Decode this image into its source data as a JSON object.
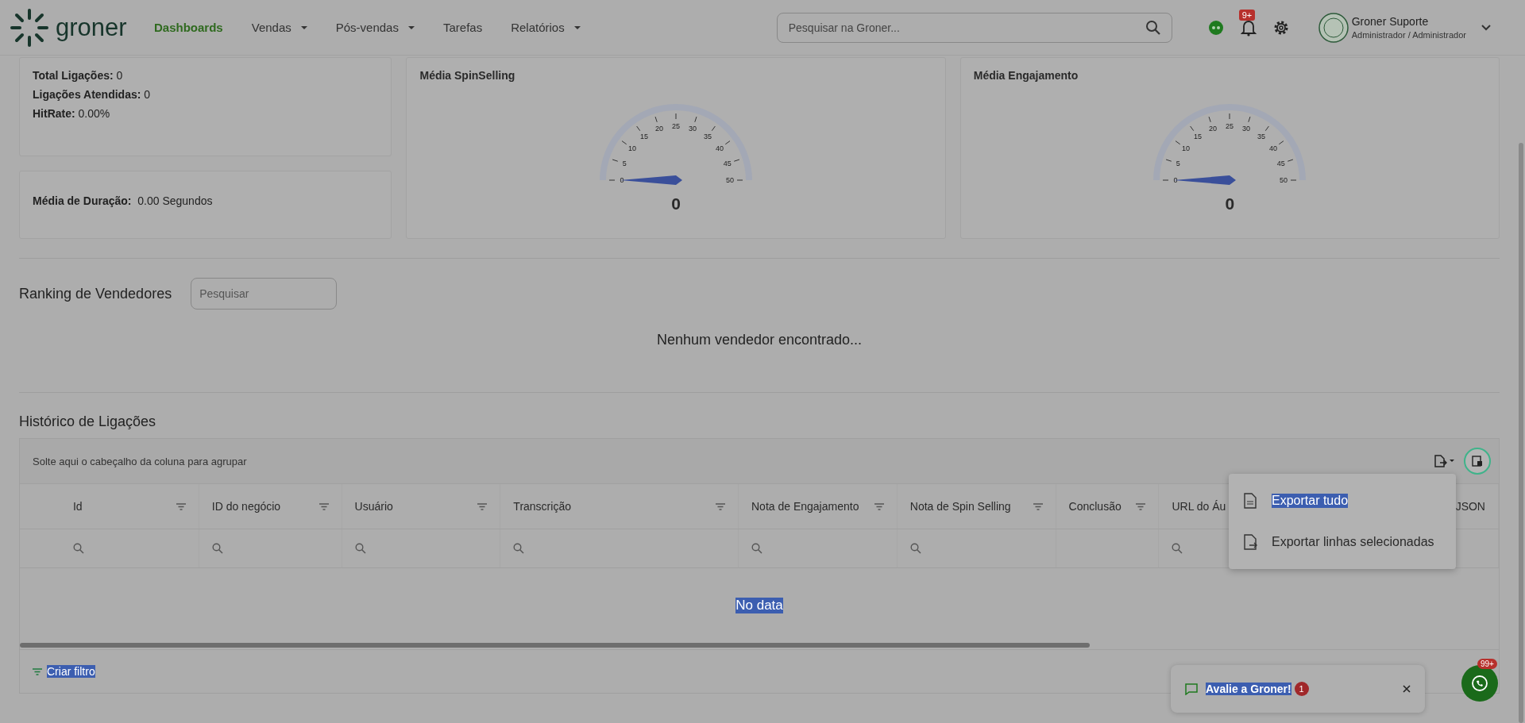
{
  "header": {
    "logo": "groner",
    "nav": [
      {
        "label": "Dashboards",
        "selected": true,
        "dropdown": false
      },
      {
        "label": "Vendas",
        "selected": false,
        "dropdown": true
      },
      {
        "label": "Pós-vendas",
        "selected": false,
        "dropdown": true
      },
      {
        "label": "Tarefas",
        "selected": false,
        "dropdown": false
      },
      {
        "label": "Relatórios",
        "selected": false,
        "dropdown": true
      }
    ],
    "search": {
      "placeholder": "Pesquisar na Groner..."
    },
    "notifications_badge": "9+",
    "user": {
      "name": "Groner Suporte",
      "role": "Administrador / Administrador"
    }
  },
  "stats": [
    {
      "label": "Total Ligações:",
      "value": "0"
    },
    {
      "label": "Ligações Atendidas:",
      "value": "0"
    },
    {
      "label": "HitRate:",
      "value": "0.00%"
    }
  ],
  "duration": {
    "label": "Média de Duração:",
    "value": "0.00 Segundos"
  },
  "gauges": [
    {
      "title": "Média SpinSelling",
      "ticks": [
        "0",
        "5",
        "10",
        "15",
        "20",
        "25",
        "30",
        "35",
        "40",
        "45",
        "50"
      ],
      "value": "0"
    },
    {
      "title": "Média Engajamento",
      "ticks": [
        "0",
        "5",
        "10",
        "15",
        "20",
        "25",
        "30",
        "35",
        "40",
        "45",
        "50"
      ],
      "value": "0"
    }
  ],
  "ranking": {
    "title": "Ranking de Vendedores",
    "search": {
      "placeholder": "Pesquisar"
    },
    "empty": "Nenhum vendedor encontrado..."
  },
  "history": {
    "title": "Histórico de Ligações",
    "group_hint": "Solte aqui o cabeçalho da coluna para agrupar",
    "columns": [
      {
        "label": "Id",
        "filter": true,
        "search": true
      },
      {
        "label": "ID do negócio",
        "filter": true,
        "search": true
      },
      {
        "label": "Usuário",
        "filter": true,
        "search": true
      },
      {
        "label": "Transcrição",
        "filter": true,
        "search": true
      },
      {
        "label": "Nota de Engajamento",
        "filter": true,
        "search": true
      },
      {
        "label": "Nota de Spin Selling",
        "filter": true,
        "search": true
      },
      {
        "label": "Conclusão",
        "filter": true,
        "search": false
      },
      {
        "label": "URL do Áu",
        "filter": false,
        "search": true
      },
      {
        "label": "JSON",
        "filter": false
      }
    ],
    "empty": {
      "text": "No data",
      "highlighted": true
    },
    "footer": {
      "label": "Criar filtro",
      "highlighted": true
    }
  },
  "export_menu": {
    "items": [
      {
        "label": "Exportar tudo",
        "highlighted": true
      },
      {
        "label": "Exportar linhas selecionadas",
        "highlighted": false
      }
    ]
  },
  "toast": {
    "text": "Avalie a Groner!",
    "highlighted": true,
    "count": "1"
  },
  "chat_badge": "99+"
}
